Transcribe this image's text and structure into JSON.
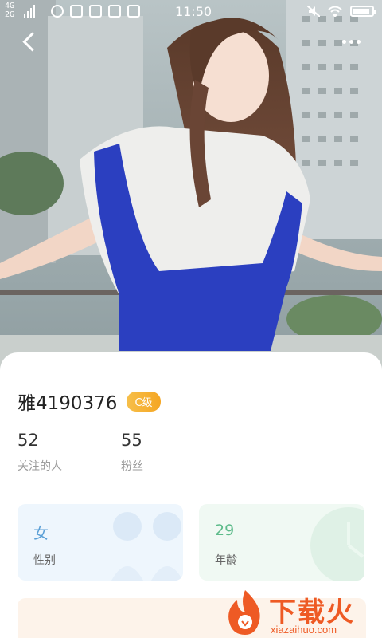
{
  "status_bar": {
    "network_top": "4G",
    "network_bottom": "2G",
    "time": "11:50"
  },
  "profile": {
    "username": "雅4190376",
    "level_badge": "C级",
    "stats": [
      {
        "value": "52",
        "label": "关注的人"
      },
      {
        "value": "55",
        "label": "粉丝"
      }
    ],
    "info": {
      "gender": {
        "value": "女",
        "label": "性别"
      },
      "age": {
        "value": "29",
        "label": "年龄"
      }
    }
  },
  "colors": {
    "badge": "#f5a623",
    "gender_tile_bg": "#eef6fd",
    "age_tile_bg": "#f0f9f3",
    "watermark": "#ee5a24"
  },
  "icons": {
    "back": "back-arrow-icon",
    "more": "more-dots-icon"
  },
  "watermark": {
    "brand": "下载火",
    "domain": "xiazaihuo.com"
  }
}
